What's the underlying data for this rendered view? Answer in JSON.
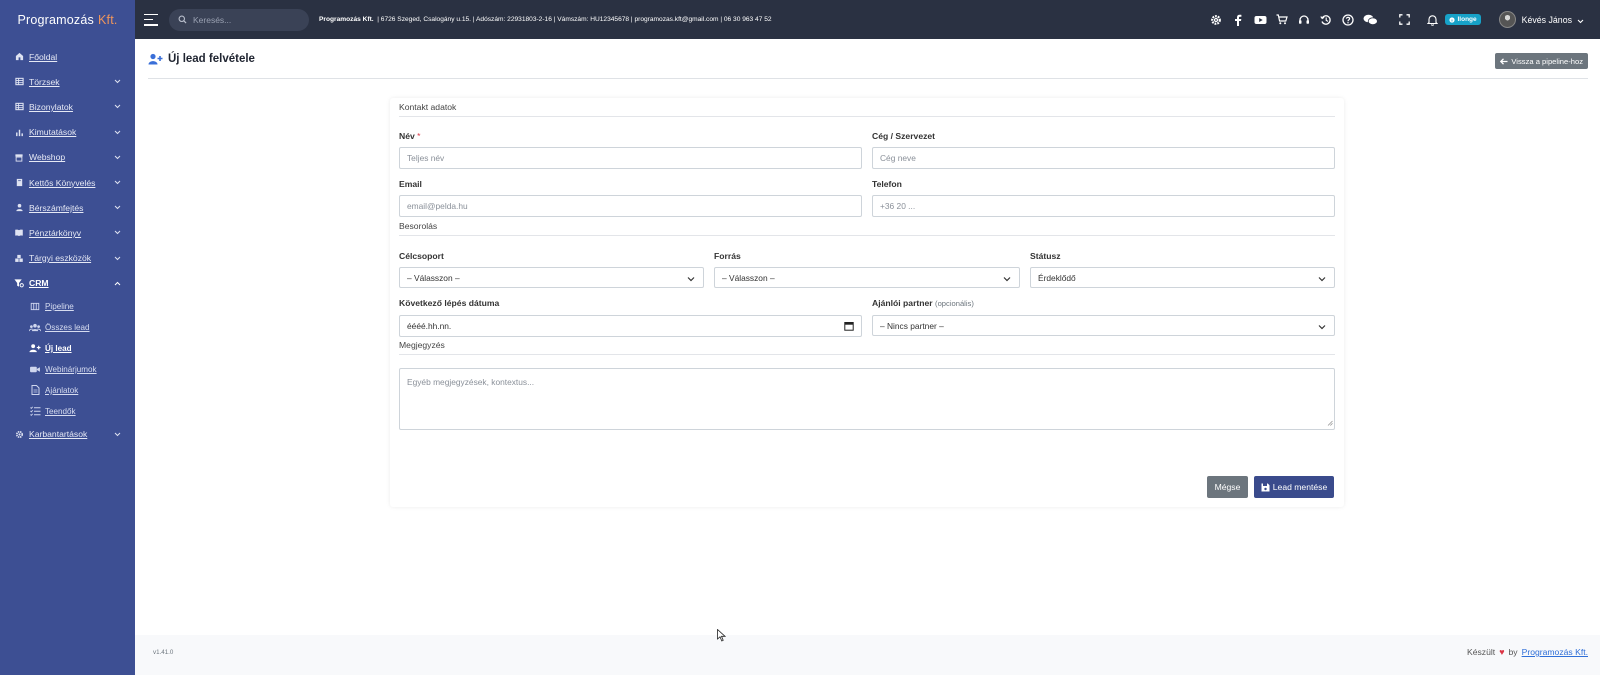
{
  "brand": {
    "name": "Programozás",
    "suffix": "Kft."
  },
  "sidebar": {
    "items": [
      {
        "label": "Főoldal",
        "icon": "home-icon"
      },
      {
        "label": "Törzsek",
        "icon": "table-icon"
      },
      {
        "label": "Bizonylatok",
        "icon": "table-icon"
      },
      {
        "label": "Kimutatások",
        "icon": "chart-icon"
      },
      {
        "label": "Webshop",
        "icon": "store-icon"
      },
      {
        "label": "Kettős Könyvelés",
        "icon": "book-icon"
      },
      {
        "label": "Bérszámfejtés",
        "icon": "user-icon"
      },
      {
        "label": "Pénztárkönyv",
        "icon": "book-open-icon"
      },
      {
        "label": "Tárgyi eszközök",
        "icon": "boxes-icon"
      },
      {
        "label": "CRM",
        "icon": "funnel-icon"
      },
      {
        "label": "Karbantartások",
        "icon": "gear-icon"
      }
    ],
    "crm_sub": [
      {
        "label": "Pipeline",
        "icon": "columns-icon"
      },
      {
        "label": "Összes lead",
        "icon": "users-icon"
      },
      {
        "label": "Új lead",
        "icon": "user-plus-icon"
      },
      {
        "label": "Webinárjumok",
        "icon": "video-icon"
      },
      {
        "label": "Ajánlatok",
        "icon": "document-icon"
      },
      {
        "label": "Teendők",
        "icon": "tasks-icon"
      }
    ]
  },
  "topbar": {
    "search_placeholder": "Keresés...",
    "company_name": "Programozás Kft.",
    "company_details": "| 6726 Szeged, Csalogány u.15. | Adószám: 22931803-2-16 | Vámszám: HU12345678 | programozas.kft@gmail.com | 06 30 963 47 52",
    "badge": "Ilonge",
    "user_name": "Kévés János"
  },
  "page": {
    "title": "Új lead felvétele",
    "back_button": "Vissza a pipeline-hoz"
  },
  "form": {
    "section_contact": "Kontakt adatok",
    "name_label": "Név",
    "required_mark": "*",
    "name_placeholder": "Teljes név",
    "company_label": "Cég / Szervezet",
    "company_placeholder": "Cég neve",
    "email_label": "Email",
    "email_placeholder": "email@pelda.hu",
    "phone_label": "Telefon",
    "phone_placeholder": "+36 20 ...",
    "section_classification": "Besorolás",
    "target_label": "Célcsoport",
    "target_value": "– Válasszon –",
    "source_label": "Forrás",
    "source_value": "– Válasszon –",
    "status_label": "Státusz",
    "status_value": "Érdeklődő",
    "next_step_label": "Következő lépés dátuma",
    "next_step_value": "éééé.hh.nn.",
    "partner_label": "Ajánlói partner",
    "partner_optional": "(opcionális)",
    "partner_value": "– Nincs partner –",
    "section_note": "Megjegyzés",
    "note_placeholder": "Egyéb megjegyzések, kontextus...",
    "cancel_button": "Mégse",
    "save_button": "Lead mentése"
  },
  "footer": {
    "version": "v1.41.0",
    "made_text": "Készült",
    "by_text": "by",
    "link_text": "Programozás Kft."
  },
  "colors": {
    "sidebar_bg": "#3d4f93",
    "topbar_bg": "#2a3142",
    "brand_accent": "#f0955b",
    "primary": "#3a4b8c",
    "secondary": "#6c757d"
  }
}
